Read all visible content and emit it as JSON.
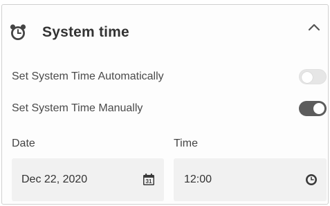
{
  "section": {
    "title": "System time",
    "icon": "alarm-clock-icon",
    "collapse_icon": "chevron-up-icon",
    "expanded": true
  },
  "settings": [
    {
      "label": "Set System Time Automatically",
      "enabled": false
    },
    {
      "label": "Set System Time  Manually",
      "enabled": true
    }
  ],
  "date_field": {
    "label": "Date",
    "value": "Dec 22, 2020",
    "icon": "calendar-icon",
    "icon_text": "31"
  },
  "time_field": {
    "label": "Time",
    "value": "12:00",
    "icon": "clock-icon"
  },
  "colors": {
    "toggle_on": "#5c5c5c",
    "toggle_off": "#e6e6e6",
    "field_background": "#f1f1f1"
  }
}
